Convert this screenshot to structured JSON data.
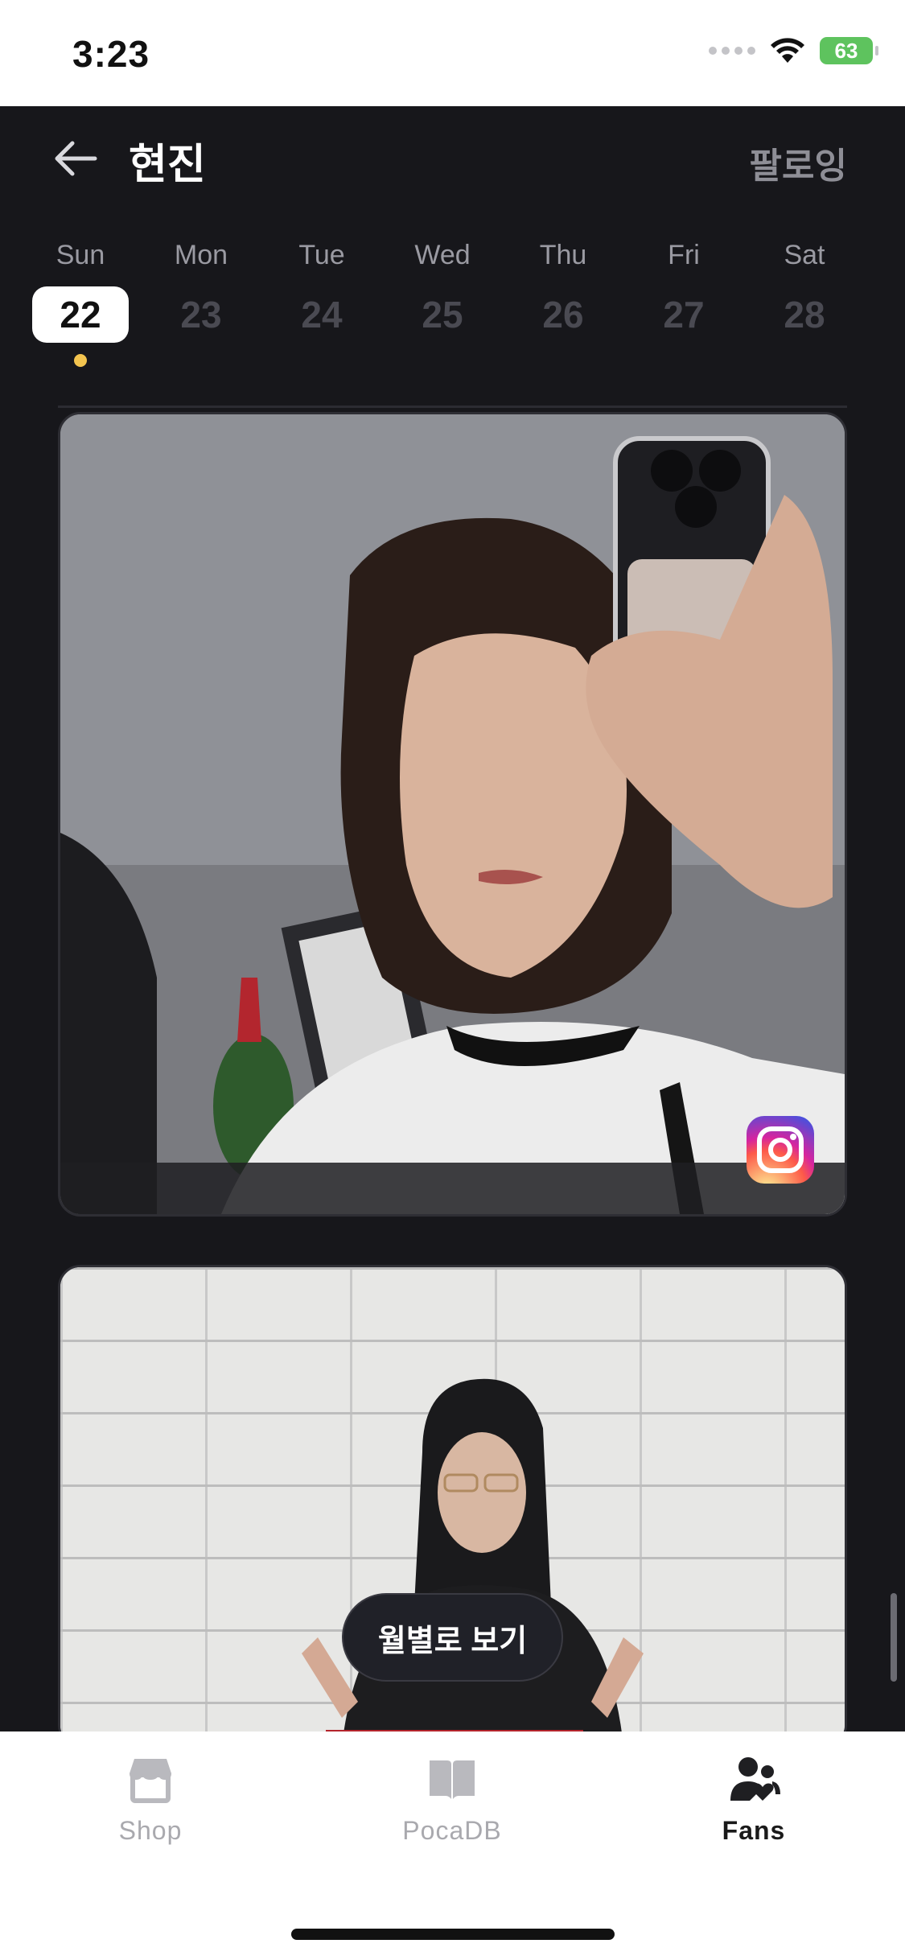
{
  "status_bar": {
    "time": "3:23",
    "battery": "63"
  },
  "header": {
    "title": "현진",
    "follow_label": "팔로잉"
  },
  "week": [
    {
      "name": "Sun",
      "num": "22",
      "selected": true,
      "has_dot": true
    },
    {
      "name": "Mon",
      "num": "23"
    },
    {
      "name": "Tue",
      "num": "24"
    },
    {
      "name": "Wed",
      "num": "25"
    },
    {
      "name": "Thu",
      "num": "26"
    },
    {
      "name": "Fri",
      "num": "27"
    },
    {
      "name": "Sat",
      "num": "28"
    }
  ],
  "feed": {
    "cards": [
      {
        "source": "instagram"
      },
      {
        "source": "photo"
      }
    ]
  },
  "monthly_button": {
    "label": "월별로 보기"
  },
  "tabbar": {
    "items": [
      {
        "label": "Shop",
        "icon": "store-icon",
        "active": false
      },
      {
        "label": "PocaDB",
        "icon": "book-icon",
        "active": false
      },
      {
        "label": "Fans",
        "icon": "fans-icon",
        "active": true
      }
    ]
  },
  "colors": {
    "accent_dot": "#f3c44f",
    "background": "#17171b"
  }
}
